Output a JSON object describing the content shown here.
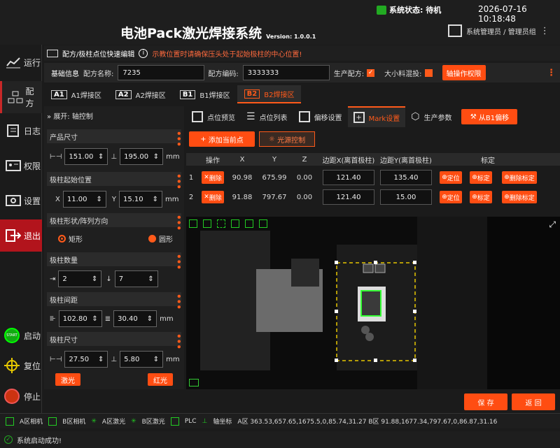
{
  "header": {
    "system_status": "系统状态: 待机",
    "datetime": "2026-07-16 10:18:48",
    "title": "电池Pack激光焊接系统",
    "version": "Version: 1.0.0.1",
    "user": "系统管理员 / 管理员组"
  },
  "sidebar": {
    "items": [
      {
        "label": "运行"
      },
      {
        "label": "配方"
      },
      {
        "label": "日志"
      },
      {
        "label": "权限"
      },
      {
        "label": "设置"
      },
      {
        "label": "退出"
      }
    ],
    "controls": [
      {
        "label": "启动"
      },
      {
        "label": "复位"
      },
      {
        "label": "停止"
      }
    ]
  },
  "breadcrumb": {
    "title": "配方/极柱点位快速编辑",
    "warning": "示教位置时请确保压头处于起始极柱的中心位置!"
  },
  "base": {
    "section": "基础信息",
    "recipe_name_label": "配方名称:",
    "recipe_name": "7235",
    "recipe_code_label": "配方编码:",
    "recipe_code": "3333333",
    "production_label": "生产配方:",
    "mix_label": "大小料混投:",
    "axis_button": "轴操作权限"
  },
  "zones": [
    {
      "key": "A1",
      "label": "A1焊接区"
    },
    {
      "key": "A2",
      "label": "A2焊接区"
    },
    {
      "key": "B1",
      "label": "B1焊接区"
    },
    {
      "key": "B2",
      "label": "B2焊接区"
    }
  ],
  "left": {
    "expand": "展开: 轴控制",
    "product_size": "产品尺寸",
    "size_w": "151.00",
    "size_h": "195.00",
    "unit": "mm",
    "start_pos": "极柱起始位置",
    "x_label": "X",
    "x": "11.00",
    "y_label": "Y",
    "y": "15.10",
    "shape": "极柱形状/阵列方向",
    "rect": "矩形",
    "circle": "圆形",
    "count": "极柱数量",
    "count_x": "2",
    "count_y": "7",
    "spacing": "极柱间距",
    "sp_x": "102.80",
    "sp_y": "30.40",
    "pole_size": "极柱尺寸",
    "ps_w": "27.50",
    "ps_h": "5.80",
    "laser": "激光",
    "red": "红光"
  },
  "tabs": [
    {
      "label": "点位预览"
    },
    {
      "label": "点位列表"
    },
    {
      "label": "偏移设置"
    },
    {
      "label": "Mark设置"
    },
    {
      "label": "生产参数"
    }
  ],
  "offset_button": "从B1偏移",
  "actions": {
    "add": "添加当前点",
    "light": "光源控制"
  },
  "table": {
    "headers": [
      "操作",
      "X",
      "Y",
      "Z",
      "边距X(离首极柱)",
      "边距Y(离首极柱)",
      "标定"
    ],
    "rows": [
      {
        "idx": "1",
        "del": "删除",
        "x": "90.98",
        "y": "675.99",
        "z": "0.00",
        "mx": "121.40",
        "my": "135.40"
      },
      {
        "idx": "2",
        "del": "删除",
        "x": "91.88",
        "y": "797.67",
        "z": "0.00",
        "mx": "121.40",
        "my": "15.00"
      }
    ],
    "locate": "定位",
    "calib": "标定",
    "del_calib": "删除标定"
  },
  "footer": {
    "save": "保 存",
    "back": "返 回"
  },
  "devices": [
    {
      "label": "A区相机"
    },
    {
      "label": "B区相机"
    },
    {
      "label": "A区激光"
    },
    {
      "label": "B区激光"
    },
    {
      "label": "PLC"
    },
    {
      "label": "轴坐标"
    }
  ],
  "axis_coords": "A区 363.53,657.65,1675.5,0,85.74,31.27 B区 91.88,1677.34,797.67,0,86.87,31.16",
  "status_msg": "系统启动成功!"
}
